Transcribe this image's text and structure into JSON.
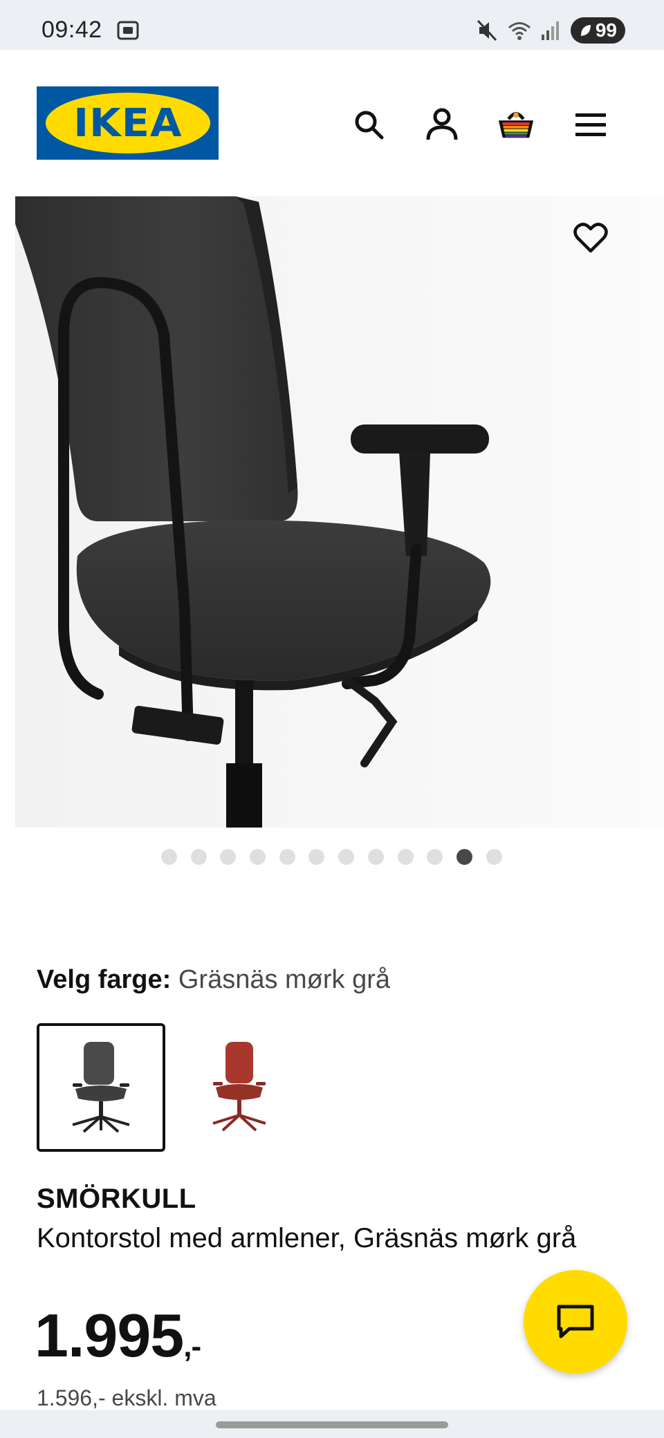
{
  "status_bar": {
    "time": "09:42",
    "battery": "99",
    "icons": [
      "screen-record-icon",
      "mute-icon",
      "wifi-icon",
      "signal-icon",
      "battery-icon"
    ]
  },
  "header": {
    "logo_text": "IKEA",
    "icons": [
      "search-icon",
      "account-icon",
      "cart-icon",
      "menu-icon"
    ],
    "colors": {
      "logo_blue": "#0058a3",
      "logo_yellow": "#ffdb00"
    }
  },
  "gallery": {
    "total_images": 12,
    "active_index": 10,
    "favorite_icon": "heart-icon"
  },
  "color_selector": {
    "label": "Velg farge:",
    "value": "Gräsnäs mørk grå",
    "options": [
      {
        "name": "dark-grey",
        "color": "#4a4a4a",
        "selected": true
      },
      {
        "name": "red",
        "color": "#a8382e",
        "selected": false
      }
    ]
  },
  "product": {
    "name": "SMÖRKULL",
    "description": "Kontorstol med armlener, Gräsnäs mørk grå",
    "price": "1.995",
    "price_suffix": ",-",
    "price_ex_vat": "1.596,- ekskl. mva"
  },
  "chat": {
    "icon": "chat-icon",
    "color": "#ffdb00"
  }
}
